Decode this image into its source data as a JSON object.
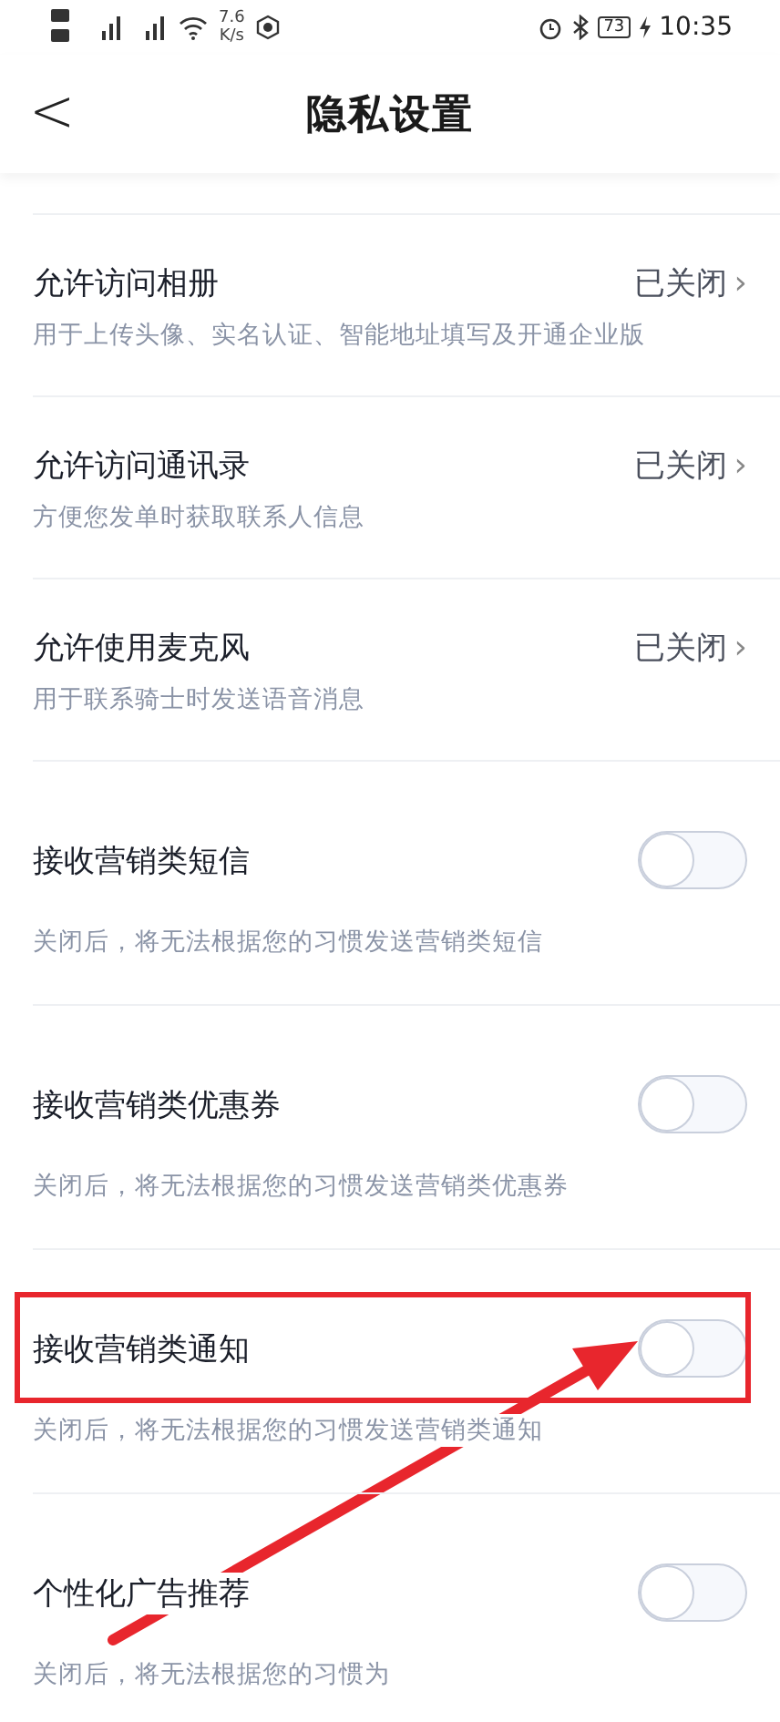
{
  "status_bar": {
    "network_speed": "7.6",
    "speed_unit": "K/s",
    "battery": "73",
    "time": "10:35"
  },
  "header": {
    "back": "<",
    "title": "隐私设置"
  },
  "items": [
    {
      "kind": "link",
      "title": "允许访问相册",
      "subtitle": "用于上传头像、实名认证、智能地址填写及开通企业版",
      "value": "已关闭",
      "chevron": "›",
      "highlighted": false
    },
    {
      "kind": "link",
      "title": "允许访问通讯录",
      "subtitle": "方便您发单时获取联系人信息",
      "value": "已关闭",
      "chevron": "›",
      "highlighted": false
    },
    {
      "kind": "link",
      "title": "允许使用麦克风",
      "subtitle": "用于联系骑士时发送语音消息",
      "value": "已关闭",
      "chevron": "›",
      "highlighted": false
    },
    {
      "kind": "toggle",
      "title": "接收营销类短信",
      "subtitle": "关闭后，将无法根据您的习惯发送营销类短信",
      "on": false,
      "highlighted": false
    },
    {
      "kind": "toggle",
      "title": "接收营销类优惠券",
      "subtitle": "关闭后，将无法根据您的习惯发送营销类优惠券",
      "on": false,
      "highlighted": false
    },
    {
      "kind": "toggle",
      "title": "接收营销类通知",
      "subtitle": "关闭后，将无法根据您的习惯发送营销类通知",
      "on": false,
      "highlighted": true
    },
    {
      "kind": "toggle",
      "title": "个性化广告推荐",
      "subtitle": "关闭后，将无法根据您的习惯为",
      "on": false,
      "highlighted": false
    }
  ]
}
